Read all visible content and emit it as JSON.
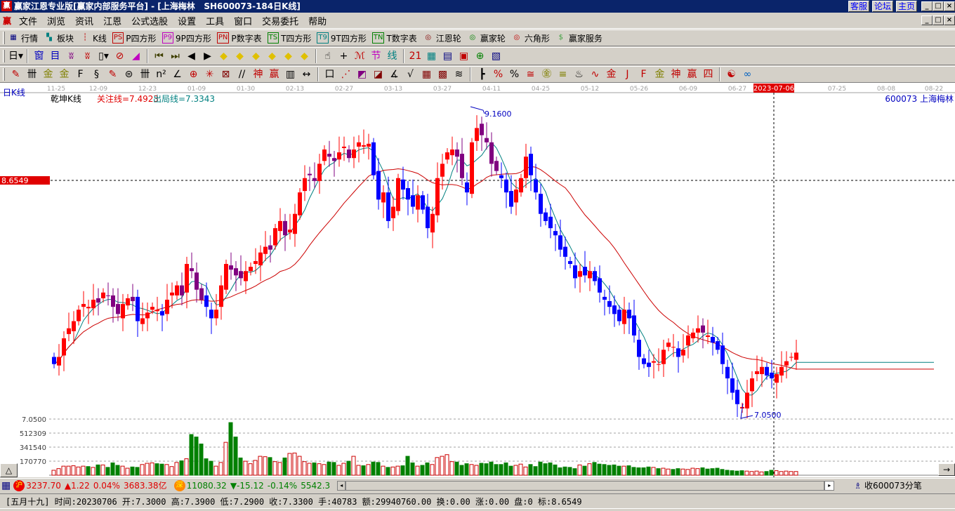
{
  "window": {
    "title": "赢家江恩专业版[赢家内部服务平台] - [上海梅林   SH600073-184日K线]",
    "logo": "赢",
    "links": [
      "客服",
      "论坛",
      "主页"
    ],
    "controls": [
      "_",
      "□",
      "×"
    ]
  },
  "menu": [
    "文件",
    "浏览",
    "资讯",
    "江恩",
    "公式选股",
    "设置",
    "工具",
    "窗口",
    "交易委托",
    "帮助"
  ],
  "toolbar1": [
    {
      "icon": "table-icon",
      "glyph": "▦",
      "label": "行情",
      "color": "#000080"
    },
    {
      "icon": "blocks-icon",
      "glyph": "▚",
      "label": "板块",
      "color": "#008080"
    },
    {
      "icon": "kline-icon",
      "glyph": "┆",
      "label": "K线",
      "color": "#c00000"
    },
    {
      "icon": "ps-icon",
      "glyph": "PS",
      "label": "P四方形",
      "color": "#c00000"
    },
    {
      "icon": "p9-icon",
      "glyph": "P9",
      "label": "9P四方形",
      "color": "#c000c0"
    },
    {
      "icon": "pn-icon",
      "glyph": "PN",
      "label": "P数字表",
      "color": "#c00000"
    },
    {
      "icon": "ts-icon",
      "glyph": "TS",
      "label": "T四方形",
      "color": "#008000"
    },
    {
      "icon": "t9-icon",
      "glyph": "T9",
      "label": "9T四方形",
      "color": "#008080"
    },
    {
      "icon": "tn-icon",
      "glyph": "TN",
      "label": "T数字表",
      "color": "#008000"
    },
    {
      "icon": "gann-wheel-icon",
      "glyph": "◎",
      "label": "江恩轮",
      "color": "#800000"
    },
    {
      "icon": "winner-wheel-icon",
      "glyph": "◎",
      "label": "赢家轮",
      "color": "#008000"
    },
    {
      "icon": "hexagon-icon",
      "glyph": "◎",
      "label": "六角形",
      "color": "#c00000"
    },
    {
      "icon": "dollar-icon",
      "glyph": "$",
      "label": "赢家服务",
      "color": "#40a040"
    }
  ],
  "toolbar2": [
    {
      "icon": "period-day-dropdown",
      "glyph": "日▾",
      "color": "#000"
    },
    {
      "icon": "sep"
    },
    {
      "icon": "pattern-icon",
      "glyph": "窗",
      "color": "#0000c0"
    },
    {
      "icon": "notes-icon",
      "glyph": "目",
      "color": "#0000c0"
    },
    {
      "icon": "wave3-icon",
      "glyph": "ʬ",
      "color": "#800080"
    },
    {
      "icon": "wave9-icon",
      "glyph": "ʬ",
      "color": "#c00000"
    },
    {
      "icon": "candle-dropdown",
      "glyph": "▯▾",
      "color": "#000"
    },
    {
      "icon": "cancel-icon",
      "glyph": "⊘",
      "color": "#c00000"
    },
    {
      "icon": "flag-icon",
      "glyph": "◢",
      "color": "#c000c0"
    },
    {
      "icon": "sep"
    },
    {
      "icon": "first-icon",
      "glyph": "⏮",
      "color": "#404000"
    },
    {
      "icon": "last-icon",
      "glyph": "⏭",
      "color": "#404000"
    },
    {
      "icon": "left-icon",
      "glyph": "◀",
      "color": "#000"
    },
    {
      "icon": "right-icon",
      "glyph": "▶",
      "color": "#000"
    },
    {
      "icon": "nav-left-icon",
      "glyph": "◆",
      "color": "#e0c000"
    },
    {
      "icon": "nav-right-icon",
      "glyph": "◆",
      "color": "#e0c000"
    },
    {
      "icon": "nav-expand-icon",
      "glyph": "◆",
      "color": "#e0c000"
    },
    {
      "icon": "nav-shrink-icon",
      "glyph": "◆",
      "color": "#e0c000"
    },
    {
      "icon": "nav-star-icon",
      "glyph": "◆",
      "color": "#e0c000"
    },
    {
      "icon": "nav-cross-icon",
      "glyph": "◆",
      "color": "#e0c000"
    },
    {
      "icon": "sep"
    },
    {
      "icon": "hand-icon",
      "glyph": "☝",
      "color": "#000"
    },
    {
      "icon": "crosshair-icon",
      "glyph": "+",
      "color": "#000"
    },
    {
      "icon": "draw-icon",
      "glyph": "ℳ",
      "color": "#c00000"
    },
    {
      "icon": "festival-icon",
      "glyph": "节",
      "color": "#c000c0"
    },
    {
      "icon": "line-icon",
      "glyph": "线",
      "color": "#008080"
    },
    {
      "icon": "sep"
    },
    {
      "icon": "calendar-icon",
      "glyph": "21",
      "color": "#c00000"
    },
    {
      "icon": "calculator-icon",
      "glyph": "▦",
      "color": "#008080"
    },
    {
      "icon": "report-icon",
      "glyph": "▤",
      "color": "#000080"
    },
    {
      "icon": "save-icon",
      "glyph": "▣",
      "color": "#c00000"
    },
    {
      "icon": "network-icon",
      "glyph": "⊕",
      "color": "#008000"
    },
    {
      "icon": "trade-icon",
      "glyph": "▧",
      "color": "#000080"
    }
  ],
  "toolbar3": [
    {
      "icon": "pen-icon",
      "glyph": "✎",
      "color": "#c00000"
    },
    {
      "icon": "grid1-icon",
      "glyph": "卌",
      "color": "#000"
    },
    {
      "icon": "gold1-icon",
      "glyph": "金",
      "color": "#808000"
    },
    {
      "icon": "gold2-icon",
      "glyph": "金",
      "color": "#808000"
    },
    {
      "icon": "fib-icon",
      "glyph": "F",
      "color": "#000"
    },
    {
      "icon": "spiral-icon",
      "glyph": "§",
      "color": "#000"
    },
    {
      "icon": "pen2-icon",
      "glyph": "✎",
      "color": "#c00000"
    },
    {
      "icon": "circle-icon",
      "glyph": "⊜",
      "color": "#000"
    },
    {
      "icon": "grid2-icon",
      "glyph": "卌",
      "color": "#000"
    },
    {
      "icon": "n2-icon",
      "glyph": "n²",
      "color": "#000"
    },
    {
      "icon": "angle-icon",
      "glyph": "∠",
      "color": "#000"
    },
    {
      "icon": "target-icon",
      "glyph": "⊕",
      "color": "#c00000"
    },
    {
      "icon": "star-icon",
      "glyph": "✳",
      "color": "#c00000"
    },
    {
      "icon": "square-icon",
      "glyph": "⊠",
      "color": "#800000"
    },
    {
      "icon": "lines-icon",
      "glyph": "//",
      "color": "#000"
    },
    {
      "icon": "god-icon",
      "glyph": "神",
      "color": "#c00000"
    },
    {
      "icon": "win-icon",
      "glyph": "赢",
      "color": "#c00000"
    },
    {
      "icon": "bars-icon",
      "glyph": "▥",
      "color": "#000"
    },
    {
      "icon": "width-icon",
      "glyph": "↔",
      "color": "#000"
    },
    {
      "icon": "sep"
    },
    {
      "icon": "box-icon",
      "glyph": "口",
      "color": "#000"
    },
    {
      "icon": "fan-icon",
      "glyph": "⋰",
      "color": "#c00000"
    },
    {
      "icon": "fanbox-icon",
      "glyph": "◩",
      "color": "#800080"
    },
    {
      "icon": "fanbox2-icon",
      "glyph": "◪",
      "color": "#800000"
    },
    {
      "icon": "angle2-icon",
      "glyph": "∡",
      "color": "#000"
    },
    {
      "icon": "v-icon",
      "glyph": "√",
      "color": "#000"
    },
    {
      "icon": "grid3-icon",
      "glyph": "▦",
      "color": "#800000"
    },
    {
      "icon": "grid4-icon",
      "glyph": "▩",
      "color": "#800000"
    },
    {
      "icon": "parallel-icon",
      "glyph": "≋",
      "color": "#000"
    },
    {
      "icon": "sep"
    },
    {
      "icon": "level-icon",
      "glyph": "┣",
      "color": "#000"
    },
    {
      "icon": "percent-fan-icon",
      "glyph": "%",
      "color": "#c00000"
    },
    {
      "icon": "percent-icon",
      "glyph": "%",
      "color": "#000"
    },
    {
      "icon": "percent-lines-icon",
      "glyph": "≅",
      "color": "#c00000"
    },
    {
      "icon": "gold-coin-icon",
      "glyph": "㊎",
      "color": "#808000"
    },
    {
      "icon": "gold-lines-icon",
      "glyph": "≡",
      "color": "#808000"
    },
    {
      "icon": "fire-icon",
      "glyph": "♨",
      "color": "#000"
    },
    {
      "icon": "wave-icon",
      "glyph": "∿",
      "color": "#c00000"
    },
    {
      "icon": "gold3-icon",
      "glyph": "金",
      "color": "#c00000"
    },
    {
      "icon": "j-fan-icon",
      "glyph": "J",
      "color": "#c00000"
    },
    {
      "icon": "f-fan-icon",
      "glyph": "F",
      "color": "#c00000"
    },
    {
      "icon": "gold-fan-icon",
      "glyph": "金",
      "color": "#808000"
    },
    {
      "icon": "god-fan-icon",
      "glyph": "神",
      "color": "#c00000"
    },
    {
      "icon": "win-fan-icon",
      "glyph": "赢",
      "color": "#c00000"
    },
    {
      "icon": "four-fan-icon",
      "glyph": "四",
      "color": "#c00000"
    },
    {
      "icon": "sep"
    },
    {
      "icon": "yinyang-icon",
      "glyph": "☯",
      "color": "#c00000"
    },
    {
      "icon": "infinity-icon",
      "glyph": "∞",
      "color": "#0060c0"
    }
  ],
  "chart": {
    "period_label": "日K线",
    "indicator_name": "乾坤K线",
    "watch_line": "关注线=7.4923",
    "exit_line": "出局线=7.3343",
    "stock_label": "600073 上海梅林",
    "cursor_date": "2023-07-06",
    "cursor_price": "8.6549",
    "high_label": "9.1600",
    "low_label": "7.0500",
    "vol_axis": [
      "7.0500",
      "512309",
      "341540",
      "170770"
    ],
    "collapse_button": "△",
    "scroll_button": "→"
  },
  "chart_data": {
    "type": "candlestick",
    "dates": [
      "11-25",
      "12-09",
      "12-23",
      "01-09",
      "01-30",
      "02-13",
      "02-27",
      "03-13",
      "03-27",
      "04-11",
      "04-25",
      "05-12",
      "05-26",
      "06-09",
      "06-27",
      "07-25",
      "08-08",
      "08-22"
    ],
    "price_range": [
      7.05,
      9.16
    ],
    "closes": [
      7.4,
      7.45,
      7.58,
      7.65,
      7.7,
      7.78,
      7.82,
      7.8,
      7.85,
      7.83,
      7.9,
      7.88,
      7.8,
      7.75,
      7.82,
      7.86,
      7.84,
      7.7,
      7.72,
      7.76,
      7.8,
      7.78,
      7.74,
      7.85,
      7.9,
      7.95,
      7.88,
      8.1,
      8.05,
      7.92,
      7.85,
      7.8,
      7.72,
      7.78,
      7.95,
      8.1,
      8.06,
      8.02,
      8.0,
      8.05,
      8.08,
      8.12,
      8.18,
      8.22,
      8.2,
      8.35,
      8.4,
      8.3,
      8.34,
      8.45,
      8.6,
      8.7,
      8.72,
      8.68,
      8.8,
      8.9,
      8.85,
      8.82,
      8.88,
      8.92,
      8.84,
      8.9,
      8.95,
      8.93,
      8.94,
      8.72,
      8.55,
      8.6,
      8.4,
      8.5,
      8.7,
      8.62,
      8.55,
      8.5,
      8.58,
      8.48,
      8.35,
      8.45,
      8.7,
      8.8,
      8.88,
      8.9,
      8.85,
      8.7,
      8.6,
      8.95,
      9.05,
      9.0,
      8.95,
      8.8,
      8.75,
      8.7,
      8.6,
      8.5,
      8.62,
      8.7,
      8.85,
      8.72,
      8.6,
      8.45,
      8.4,
      8.35,
      8.3,
      8.2,
      8.15,
      8.1,
      8.0,
      8.05,
      8.02,
      8.05,
      7.98,
      7.9,
      7.85,
      7.8,
      7.75,
      7.7,
      7.78,
      7.72,
      7.6,
      7.45,
      7.4,
      7.38,
      7.42,
      7.4,
      7.5,
      7.55,
      7.52,
      7.45,
      7.5,
      7.6,
      7.62,
      7.65,
      7.62,
      7.6,
      7.55,
      7.5,
      7.4,
      7.3,
      7.2,
      7.12,
      7.1,
      7.2,
      7.3,
      7.35,
      7.38,
      7.32,
      7.3,
      7.33,
      7.38,
      7.42,
      7.45,
      7.48
    ],
    "volumes_k": [
      60,
      80,
      110,
      110,
      115,
      100,
      110,
      105,
      95,
      125,
      125,
      95,
      150,
      120,
      110,
      85,
      100,
      95,
      130,
      145,
      150,
      140,
      135,
      130,
      105,
      155,
      175,
      200,
      495,
      465,
      380,
      200,
      170,
      110,
      155,
      400,
      640,
      465,
      210,
      170,
      140,
      180,
      230,
      225,
      215,
      165,
      155,
      210,
      265,
      270,
      230,
      165,
      145,
      150,
      140,
      130,
      160,
      155,
      120,
      145,
      170,
      230,
      120,
      115,
      130,
      160,
      155,
      110,
      95,
      100,
      110,
      115,
      230,
      150,
      110,
      120,
      150,
      130,
      215,
      230,
      250,
      165,
      160,
      120,
      140,
      130,
      120,
      145,
      140,
      160,
      130,
      130,
      150,
      110,
      120,
      135,
      100,
      130,
      105,
      160,
      140,
      150,
      125,
      90,
      100,
      95,
      80,
      125,
      110,
      140,
      155,
      135,
      130,
      120,
      125,
      110,
      110,
      115,
      95,
      90,
      90,
      100,
      95,
      80,
      85,
      75,
      70,
      80,
      75,
      70,
      85,
      80,
      90,
      75,
      80,
      85,
      70,
      60,
      55,
      50,
      55,
      50,
      45,
      50,
      40,
      45,
      60,
      55,
      45,
      50,
      45,
      45
    ],
    "colors": {
      "up": "#ff0000",
      "down": "#0000ff",
      "down_above_ma": "#800080",
      "vol_up": "#cc0000",
      "vol_down": "#008000",
      "ma_short": "#008080",
      "ma_long": "#cc0000"
    }
  },
  "status": {
    "sh_badge": "沪",
    "sh_index": "3237.70",
    "sh_change": "▲1.22",
    "sh_pct": "0.04%",
    "sh_amount": "3683.38亿",
    "sz_badge": "深",
    "sz_index": "11080.32",
    "sz_change": "▼-15.12",
    "sz_pct": "-0.14%",
    "sz_amount": "5542.3",
    "tick_label": "收600073分笔"
  },
  "info": "[五月十九] 时间:20230706 开:7.3000 高:7.3900 低:7.2900 收:7.3300 手:40783 额:29940760.00 换:0.00 涨:0.00 盘:0 标:8.6549"
}
